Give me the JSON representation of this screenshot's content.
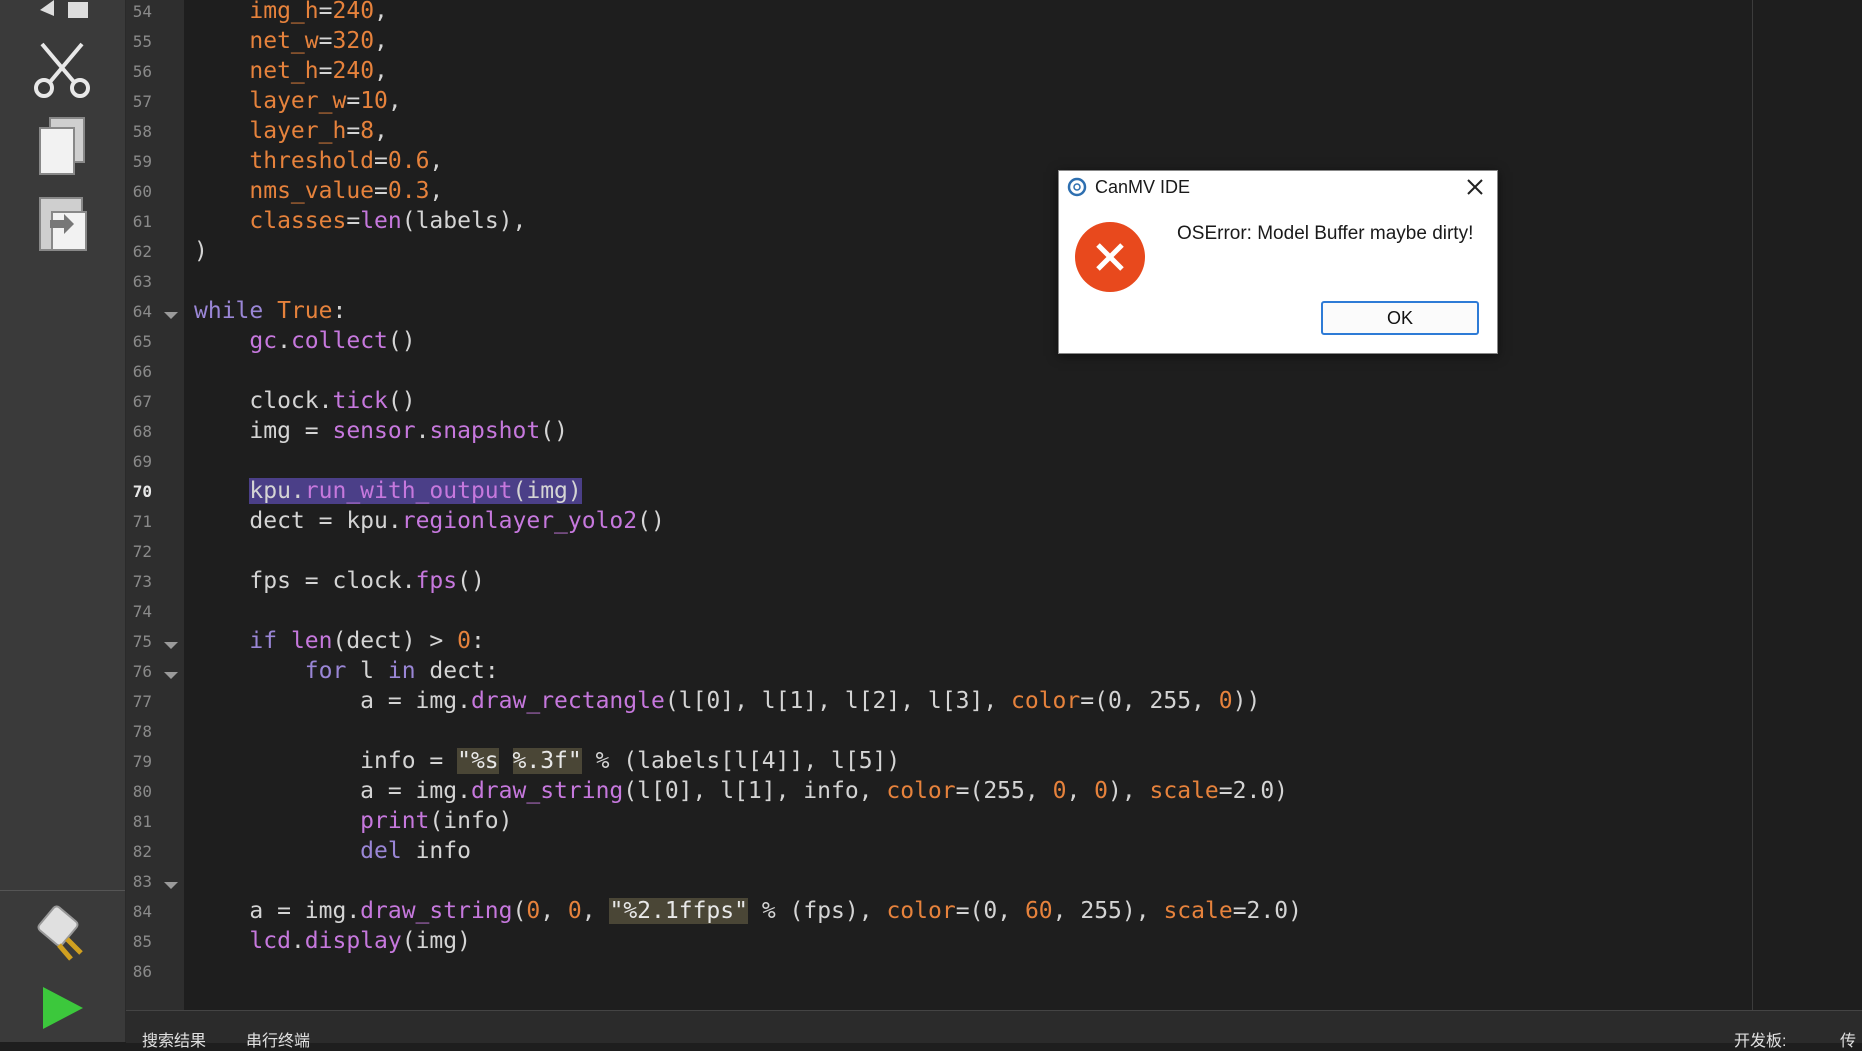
{
  "editor": {
    "current_line": "70",
    "lines": [
      {
        "n": "54",
        "t": [
          [
            "    ",
            ""
          ],
          [
            "img_h",
            "param"
          ],
          [
            "=",
            ""
          ],
          [
            "240",
            "num"
          ],
          [
            ",",
            ""
          ]
        ]
      },
      {
        "n": "55",
        "t": [
          [
            "    ",
            ""
          ],
          [
            "net_w",
            "param"
          ],
          [
            "=",
            ""
          ],
          [
            "320",
            "num"
          ],
          [
            ",",
            ""
          ]
        ]
      },
      {
        "n": "56",
        "t": [
          [
            "    ",
            ""
          ],
          [
            "net_h",
            "param"
          ],
          [
            "=",
            ""
          ],
          [
            "240",
            "num"
          ],
          [
            ",",
            ""
          ]
        ]
      },
      {
        "n": "57",
        "t": [
          [
            "    ",
            ""
          ],
          [
            "layer_w",
            "param"
          ],
          [
            "=",
            ""
          ],
          [
            "10",
            "num"
          ],
          [
            ",",
            ""
          ]
        ]
      },
      {
        "n": "58",
        "t": [
          [
            "    ",
            ""
          ],
          [
            "layer_h",
            "param"
          ],
          [
            "=",
            ""
          ],
          [
            "8",
            "num"
          ],
          [
            ",",
            ""
          ]
        ]
      },
      {
        "n": "59",
        "t": [
          [
            "    ",
            ""
          ],
          [
            "threshold",
            "param"
          ],
          [
            "=",
            ""
          ],
          [
            "0.6",
            "num"
          ],
          [
            ",",
            ""
          ]
        ]
      },
      {
        "n": "60",
        "t": [
          [
            "    ",
            ""
          ],
          [
            "nms_value",
            "param"
          ],
          [
            "=",
            ""
          ],
          [
            "0.3",
            "num"
          ],
          [
            ",",
            ""
          ]
        ]
      },
      {
        "n": "61",
        "t": [
          [
            "    ",
            ""
          ],
          [
            "classes",
            "param"
          ],
          [
            "=",
            ""
          ],
          [
            "len",
            "fn"
          ],
          [
            "(labels),",
            ""
          ]
        ]
      },
      {
        "n": "62",
        "t": [
          [
            ")",
            ""
          ]
        ]
      },
      {
        "n": "63",
        "t": []
      },
      {
        "n": "64",
        "t": [
          [
            "while",
            "kw"
          ],
          [
            " ",
            ""
          ],
          [
            "True",
            "param"
          ],
          [
            ":",
            ""
          ]
        ],
        "fold": true
      },
      {
        "n": "65",
        "t": [
          [
            "    ",
            ""
          ],
          [
            "gc",
            "mod"
          ],
          [
            ".",
            ""
          ],
          [
            "collect",
            "fn"
          ],
          [
            "()",
            ""
          ]
        ]
      },
      {
        "n": "66",
        "t": []
      },
      {
        "n": "67",
        "t": [
          [
            "    ",
            ""
          ],
          [
            "clock.",
            ""
          ],
          [
            "tick",
            "fn"
          ],
          [
            "()",
            ""
          ]
        ]
      },
      {
        "n": "68",
        "t": [
          [
            "    ",
            ""
          ],
          [
            "img = ",
            ""
          ],
          [
            "sensor",
            "mod"
          ],
          [
            ".",
            ""
          ],
          [
            "snapshot",
            "fn"
          ],
          [
            "()",
            ""
          ]
        ]
      },
      {
        "n": "69",
        "t": []
      },
      {
        "n": "70",
        "t": [
          [
            "    ",
            ""
          ],
          [
            "kpu.",
            "sel"
          ],
          [
            "run_with_output",
            "sel fn"
          ],
          [
            "(img)",
            "sel"
          ]
        ]
      },
      {
        "n": "71",
        "t": [
          [
            "    ",
            ""
          ],
          [
            "dect = kpu.",
            ""
          ],
          [
            "regionlayer_yolo2",
            "fn"
          ],
          [
            "()",
            ""
          ]
        ]
      },
      {
        "n": "72",
        "t": []
      },
      {
        "n": "73",
        "t": [
          [
            "    ",
            ""
          ],
          [
            "fps = clock.",
            ""
          ],
          [
            "fps",
            "fn"
          ],
          [
            "()",
            ""
          ]
        ]
      },
      {
        "n": "74",
        "t": []
      },
      {
        "n": "75",
        "t": [
          [
            "    ",
            ""
          ],
          [
            "if",
            "kw"
          ],
          [
            " ",
            ""
          ],
          [
            "len",
            "fn"
          ],
          [
            "(dect) > ",
            ""
          ],
          [
            "0",
            "num"
          ],
          [
            ":",
            ""
          ]
        ],
        "fold": true
      },
      {
        "n": "76",
        "t": [
          [
            "        ",
            ""
          ],
          [
            "for",
            "kw"
          ],
          [
            " l ",
            ""
          ],
          [
            "in",
            "kw"
          ],
          [
            " dect:",
            ""
          ]
        ],
        "fold": true
      },
      {
        "n": "77",
        "t": [
          [
            "            ",
            ""
          ],
          [
            "a = img.",
            ""
          ],
          [
            "draw_rectangle",
            "fn"
          ],
          [
            "(l[0], l[1], l[2], l[3], ",
            ""
          ],
          [
            "color",
            "param"
          ],
          [
            "=(0, 255, ",
            ""
          ],
          [
            "0",
            "num"
          ],
          [
            "))",
            ""
          ]
        ]
      },
      {
        "n": "78",
        "t": []
      },
      {
        "n": "79",
        "t": [
          [
            "            ",
            ""
          ],
          [
            "info = ",
            ""
          ],
          [
            "\"%s",
            ""
          ],
          [
            " ",
            ""
          ],
          [
            "%.3f\"",
            "str"
          ],
          [
            " % (labels[l[4]], l[5])",
            ""
          ]
        ],
        "str1": true
      },
      {
        "n": "80",
        "t": [
          [
            "            ",
            ""
          ],
          [
            "a = img.",
            ""
          ],
          [
            "draw_string",
            "fn"
          ],
          [
            "(l[0], l[1], info, ",
            ""
          ],
          [
            "color",
            "param"
          ],
          [
            "=(255, ",
            ""
          ],
          [
            "0",
            "num"
          ],
          [
            ", ",
            ""
          ],
          [
            "0",
            "num"
          ],
          [
            "), ",
            ""
          ],
          [
            "scale",
            "param"
          ],
          [
            "=2.0)",
            ""
          ]
        ]
      },
      {
        "n": "81",
        "t": [
          [
            "            ",
            ""
          ],
          [
            "print",
            "fn"
          ],
          [
            "(info)",
            ""
          ]
        ]
      },
      {
        "n": "82",
        "t": [
          [
            "            ",
            ""
          ],
          [
            "del",
            "kw"
          ],
          [
            " info",
            ""
          ]
        ]
      },
      {
        "n": "83",
        "t": [],
        "fold": true
      },
      {
        "n": "84",
        "t": [
          [
            "    ",
            ""
          ],
          [
            "a = img.",
            ""
          ],
          [
            "draw_string",
            "fn"
          ],
          [
            "(",
            ""
          ],
          [
            "0",
            "num"
          ],
          [
            ", ",
            ""
          ],
          [
            "0",
            "num"
          ],
          [
            ", ",
            ""
          ],
          [
            "\"%2.1ffps\"",
            "str"
          ],
          [
            " % (fps), ",
            ""
          ],
          [
            "color",
            "param"
          ],
          [
            "=(0, ",
            ""
          ],
          [
            "60",
            "num"
          ],
          [
            ", 255), ",
            ""
          ],
          [
            "scale",
            "param"
          ],
          [
            "=2.0)",
            ""
          ]
        ]
      },
      {
        "n": "85",
        "t": [
          [
            "    ",
            ""
          ],
          [
            "lcd",
            "mod"
          ],
          [
            ".",
            ""
          ],
          [
            "display",
            "fn"
          ],
          [
            "(img)",
            ""
          ]
        ]
      },
      {
        "n": "86",
        "t": []
      }
    ]
  },
  "dialog": {
    "title": "CanMV IDE",
    "message": "OSError: Model Buffer maybe dirty!",
    "ok_label": "OK"
  },
  "statusbar": {
    "search_results": "搜索结果",
    "serial_terminal": "串行终端",
    "board": "开发板:",
    "right_cut": "传"
  },
  "colors": {
    "accent": "#2e7bd6",
    "error": "#e8491d",
    "run": "#3cc83c"
  }
}
